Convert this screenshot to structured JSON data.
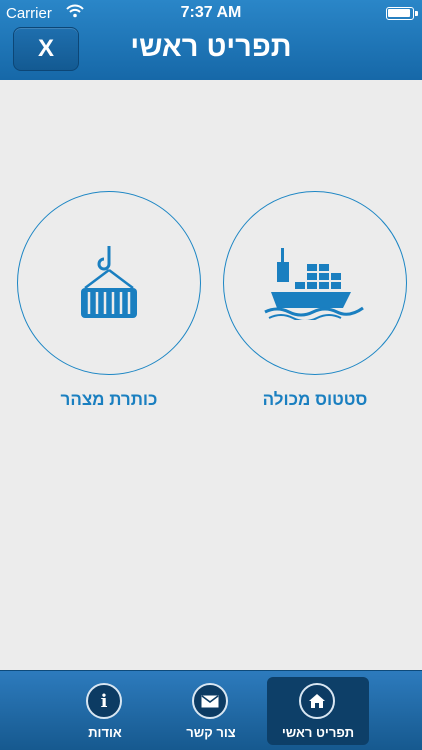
{
  "status_bar": {
    "carrier": "Carrier",
    "time": "7:37 AM"
  },
  "header": {
    "title": "תפריט ראשי",
    "close_label": "X"
  },
  "menu": {
    "items": [
      {
        "label": "כותרת מצהר",
        "icon": "crane-container-icon"
      },
      {
        "label": "סטטוס מכולה",
        "icon": "cargo-ship-icon"
      }
    ]
  },
  "tabs": [
    {
      "label": "תפריט ראשי",
      "icon": "home-icon",
      "active": true
    },
    {
      "label": "צור קשר",
      "icon": "envelope-icon",
      "active": false
    },
    {
      "label": "אודות",
      "icon": "info-icon",
      "active": false
    }
  ],
  "colors": {
    "header": "#1a73b5",
    "accent": "#1a7fc0",
    "background": "#ececec"
  }
}
